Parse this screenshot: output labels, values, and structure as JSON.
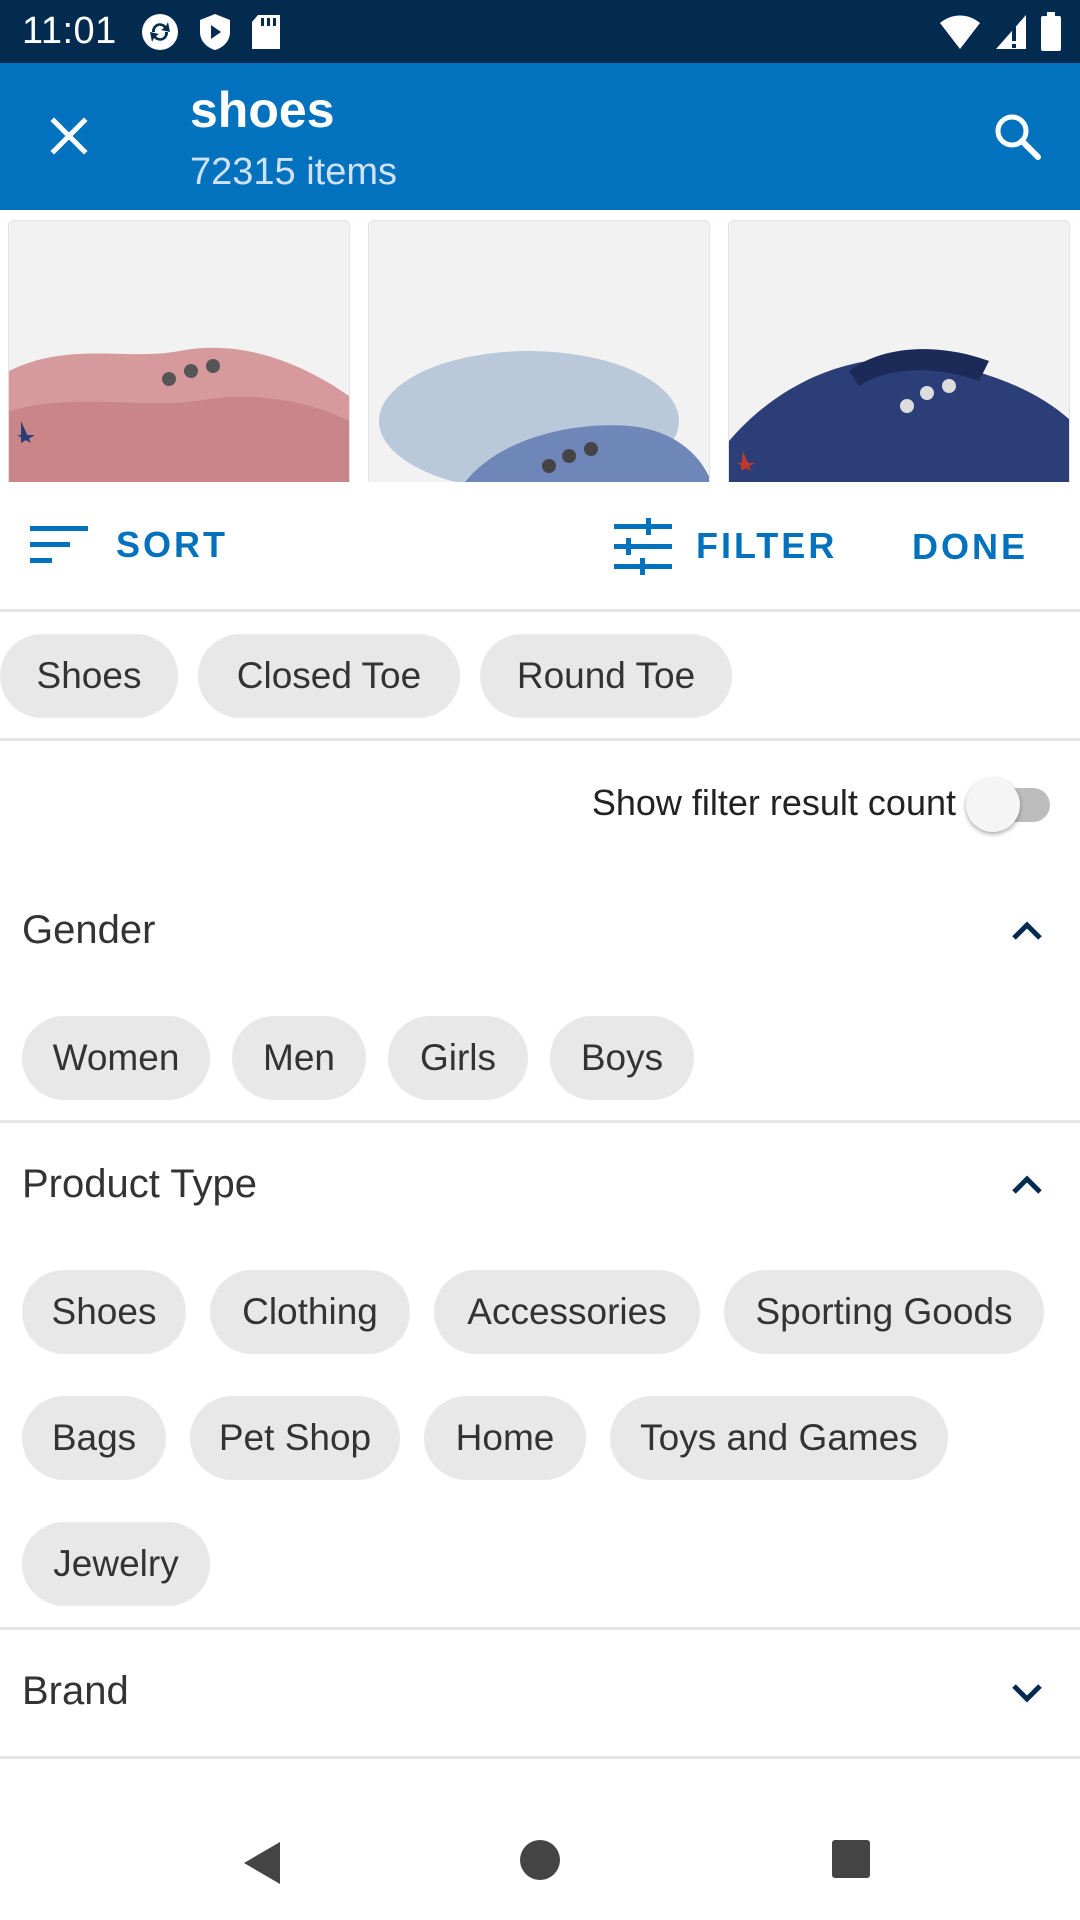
{
  "status_bar": {
    "time": "11:01",
    "left_icons": [
      "sync-icon",
      "shield-icon",
      "sd-card-icon"
    ],
    "right_icons": [
      "wifi-icon",
      "signal-icon",
      "battery-icon"
    ]
  },
  "app_bar": {
    "title": "shoes",
    "subtitle": "72315 items",
    "close_icon": "close-icon",
    "search_icon": "search-icon"
  },
  "products": [
    {
      "color": "#d79a9c"
    },
    {
      "color": "#6f86b8"
    },
    {
      "color": "#2c3e78"
    }
  ],
  "actions": {
    "sort_label": "SORT",
    "filter_label": "FILTER",
    "done_label": "DONE"
  },
  "selected_filters": [
    "Shoes",
    "Closed Toe",
    "Round Toe"
  ],
  "toggle": {
    "label": "Show filter result count",
    "on": false
  },
  "sections": {
    "gender": {
      "title": "Gender",
      "expanded": true,
      "options": [
        "Women",
        "Men",
        "Girls",
        "Boys"
      ]
    },
    "product_type": {
      "title": "Product Type",
      "expanded": true,
      "options": [
        "Shoes",
        "Clothing",
        "Accessories",
        "Sporting Goods",
        "Bags",
        "Pet Shop",
        "Home",
        "Toys and Games",
        "Jewelry"
      ]
    },
    "brand": {
      "title": "Brand",
      "expanded": false
    }
  },
  "colors": {
    "status_bar": "#032a4f",
    "app_bar": "#0271be",
    "accent": "#0271be",
    "chip_bg": "#e8e8e8"
  },
  "nav_bar": [
    "back-icon",
    "home-icon",
    "recents-icon"
  ]
}
